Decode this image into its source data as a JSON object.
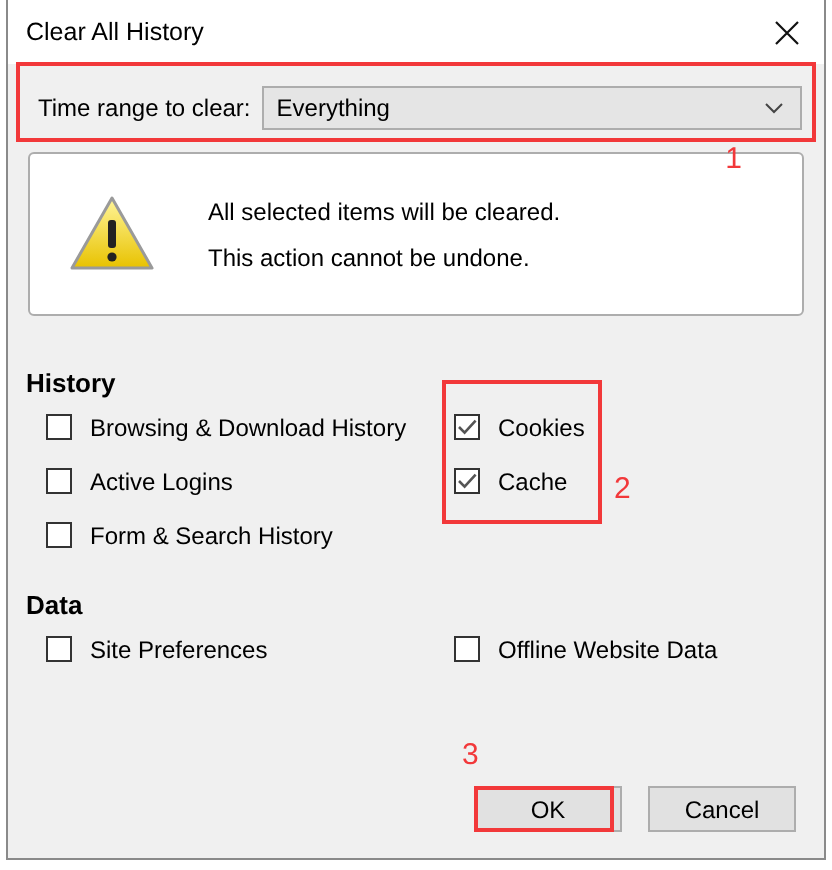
{
  "window": {
    "title": "Clear All History"
  },
  "time_range": {
    "label": "Time range to clear:",
    "value": "Everything"
  },
  "warning": {
    "lines": [
      "All selected items will be cleared.",
      "This action cannot be undone."
    ]
  },
  "sections": [
    {
      "heading": "History",
      "columns": [
        [
          {
            "label": "Browsing & Download History",
            "checked": false
          },
          {
            "label": "Active Logins",
            "checked": false
          },
          {
            "label": "Form & Search History",
            "checked": false
          }
        ],
        [
          {
            "label": "Cookies",
            "checked": true
          },
          {
            "label": "Cache",
            "checked": true
          }
        ]
      ]
    },
    {
      "heading": "Data",
      "columns": [
        [
          {
            "label": "Site Preferences",
            "checked": false
          }
        ],
        [
          {
            "label": "Offline Website Data",
            "checked": false
          }
        ]
      ]
    }
  ],
  "buttons": [
    {
      "label": "OK"
    },
    {
      "label": "Cancel"
    }
  ],
  "annotations": [
    {
      "label": "1"
    },
    {
      "label": "2"
    },
    {
      "label": "3"
    }
  ]
}
